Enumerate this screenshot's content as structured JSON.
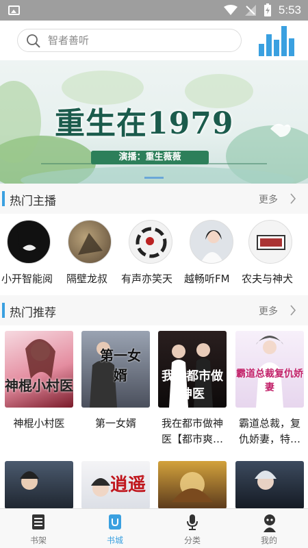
{
  "status_bar": {
    "time": "5:53"
  },
  "search": {
    "placeholder": "智者善听"
  },
  "banner": {
    "title": "重生在1979",
    "narrator": "演播：重生薇薇"
  },
  "hot_anchors": {
    "title": "热门主播",
    "more": "更多",
    "items": [
      {
        "name": "小开智能阅"
      },
      {
        "name": "隔壁龙叔"
      },
      {
        "name": "有声亦笑天"
      },
      {
        "name": "越畅听FM"
      },
      {
        "name": "农夫与神犬"
      }
    ]
  },
  "hot_recommend": {
    "title": "热门推荐",
    "more": "更多",
    "books": [
      {
        "title": "神棍小村医",
        "cover_text": "神棍小村医"
      },
      {
        "title": "第一女婿",
        "cover_text": "第一女婿"
      },
      {
        "title": "我在都市做神医【都市爽…",
        "cover_text": "我在都市做神医"
      },
      {
        "title": "霸道总裁，复仇娇妻，特…",
        "cover_text": "霸道总裁复仇娇妻"
      }
    ],
    "second_row_covers": [
      "逍遥",
      "",
      "",
      ""
    ]
  },
  "tabbar": {
    "items": [
      {
        "label": "书架",
        "icon": "bookshelf-icon"
      },
      {
        "label": "书城",
        "icon": "bookstore-icon"
      },
      {
        "label": "分类",
        "icon": "microphone-icon"
      },
      {
        "label": "我的",
        "icon": "profile-icon"
      }
    ],
    "active": 1
  },
  "colors": {
    "accent": "#3aa0e0",
    "status_bar": "#9e9e9e",
    "section_bg": "#f7f7f7"
  }
}
